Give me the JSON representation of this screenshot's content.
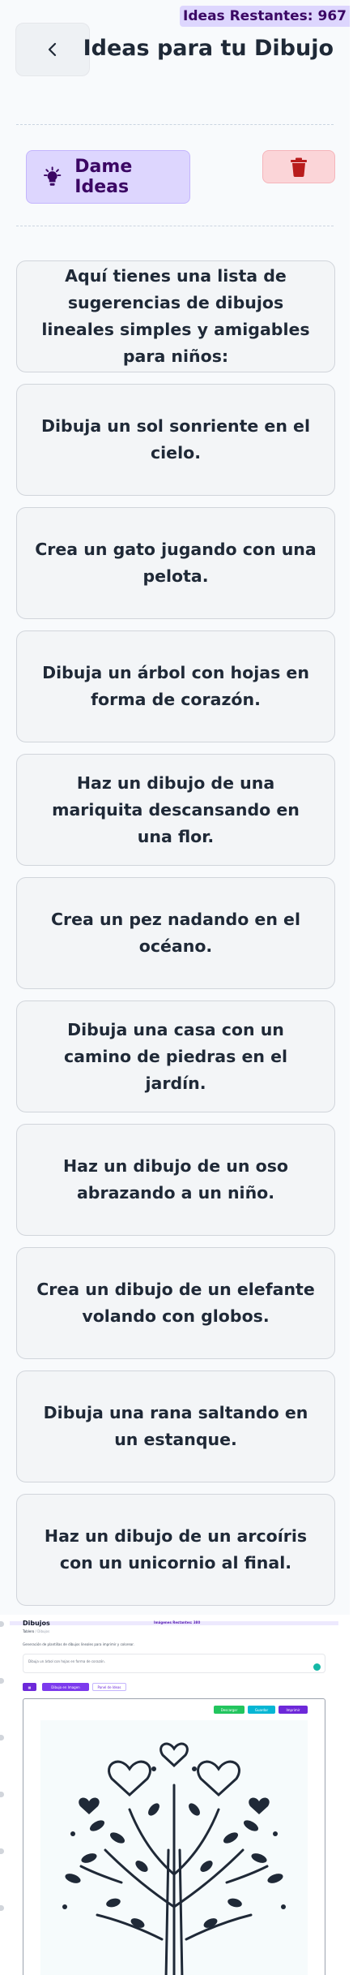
{
  "header": {
    "badge": "Ideas Restantes: 967",
    "title": "Ideas para tu Dibujo",
    "back_icon": "chevron-left-icon"
  },
  "actions": {
    "ideas_label": "Dame Ideas",
    "ideas_icon": "lightbulb-icon",
    "delete_icon": "trash-icon"
  },
  "ideas": [
    "Aquí tienes una lista de sugerencias de dibujos lineales simples y amigables para niños:",
    "Dibuja un sol sonriente en el cielo.",
    "Crea un gato jugando con una pelota.",
    "Dibuja un árbol con hojas en forma de corazón.",
    "Haz un dibujo de una mariquita descansando en una flor.",
    "Crea un pez nadando en el océano.",
    "Dibuja una casa con un camino de piedras en el jardín.",
    "Haz un dibujo de un oso abrazando a un niño.",
    "Crea un dibujo de un elefante volando con globos.",
    "Dibuja una rana saltando en un estanque.",
    "Haz un dibujo de un arcoíris con un unicornio al final."
  ],
  "preview": {
    "title": "Dibujos",
    "badge": "Imágenes Restantes: 380",
    "breadcrumb": [
      "Tablero",
      "Dibujos"
    ],
    "description": "Generación de plantillas de dibujos lineales para imprimir y colorear.",
    "prompt_value": "Dibuja un árbol con hojas en forma de corazón.",
    "toolbar": [
      "Dibujo en Imagen",
      "Panel de Ideas"
    ],
    "toolbar_icon": "grid-icon",
    "image_actions": [
      "Descargar",
      "Guardar",
      "Imprimir"
    ],
    "colors": {
      "accent": "#7c3aed",
      "download": "#22c55e",
      "save": "#06b6d4",
      "print": "#6d28d9"
    }
  }
}
